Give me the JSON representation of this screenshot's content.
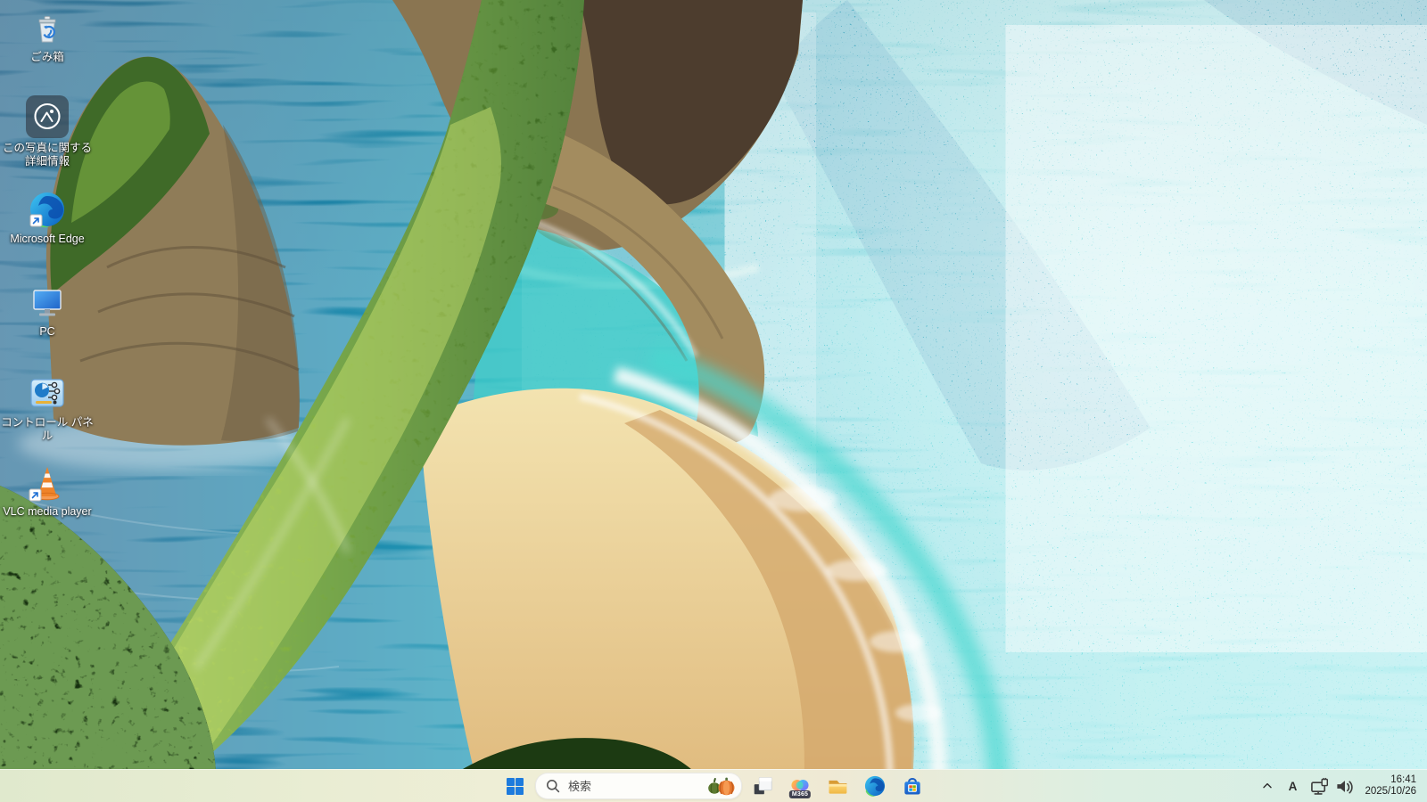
{
  "desktop": {
    "icons": [
      {
        "id": "recycle-bin",
        "label": "ごみ箱"
      },
      {
        "id": "photo-info",
        "label": "この写真に関する詳細情報"
      },
      {
        "id": "microsoft-edge",
        "label": "Microsoft Edge"
      },
      {
        "id": "pc",
        "label": "PC"
      },
      {
        "id": "control-panel",
        "label": "コントロール パネル"
      },
      {
        "id": "vlc",
        "label": "VLC media player"
      }
    ]
  },
  "taskbar": {
    "search": {
      "placeholder": "検索"
    },
    "pinned": [
      {
        "id": "window-app"
      },
      {
        "id": "m365-copilot",
        "badge": "M365"
      },
      {
        "id": "file-explorer"
      },
      {
        "id": "edge"
      },
      {
        "id": "store"
      }
    ],
    "tray": {
      "ime_label": "A",
      "time": "16:41",
      "date": "2025/10/26"
    }
  },
  "colors": {
    "start_blue": "#1d7bdd",
    "taskbar_left": "#e0e9cd",
    "taskbar_right": "#d5eee6",
    "search_pill": "#f8f8f4",
    "sea_turquoise": "#28c3cd",
    "sand": "#ecd29b"
  }
}
